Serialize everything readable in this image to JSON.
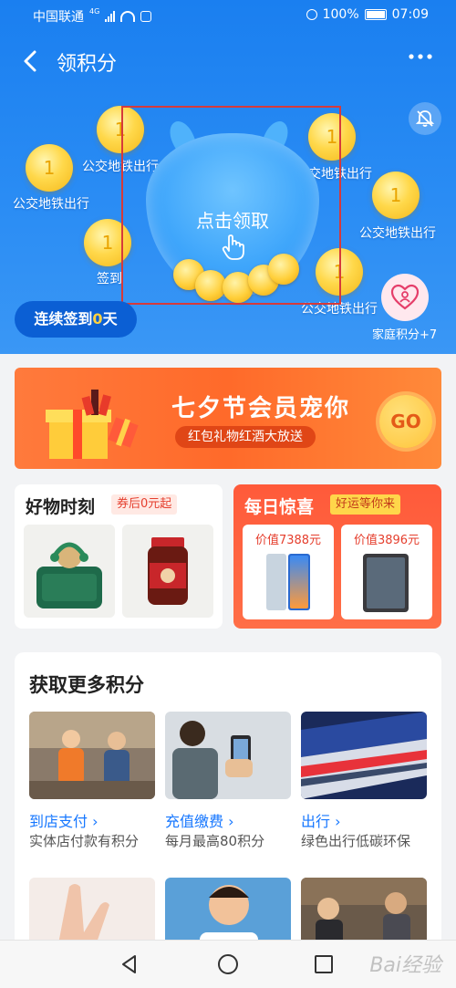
{
  "status_bar": {
    "carrier": "中国联通",
    "network": "4G",
    "battery": "100%",
    "time": "07:09"
  },
  "header": {
    "title": "领积分"
  },
  "hero": {
    "claim_text": "点击领取",
    "coins": [
      {
        "value": "1",
        "label": "公交地铁出行"
      },
      {
        "value": "1",
        "label": "公交地铁出行"
      },
      {
        "value": "1",
        "label": "签到"
      },
      {
        "value": "1",
        "label": "公交地铁出行"
      },
      {
        "value": "1",
        "label": "公交地铁出行"
      },
      {
        "value": "1",
        "label": "公交地铁出行"
      }
    ],
    "streak_prefix": "连续签到",
    "streak_days": "0",
    "streak_suffix": "天",
    "family_label": "家庭积分+7"
  },
  "banner": {
    "title": "七夕节会员宠你",
    "subtitle": "红包礼物红酒大放送",
    "go": "GO"
  },
  "good_items": {
    "title": "好物时刻",
    "tag": "券后0元起"
  },
  "daily_surprise": {
    "title": "每日惊喜",
    "tag": "好运等你来",
    "prizes": [
      {
        "price": "价值7388元"
      },
      {
        "price": "价值3896元"
      }
    ]
  },
  "more_points": {
    "title": "获取更多积分",
    "tiles": [
      {
        "title": "到店支付",
        "desc": "实体店付款有积分"
      },
      {
        "title": "充值缴费",
        "desc": "每月最高80积分"
      },
      {
        "title": "出行",
        "desc": "绿色出行低碳环保"
      }
    ]
  },
  "watermark": "Bai经验",
  "colors": {
    "hero_blue": "#1a7ff0",
    "accent_orange": "#ff6a2a",
    "link_blue": "#1677ff",
    "coin_gold": "#ffd84a"
  }
}
